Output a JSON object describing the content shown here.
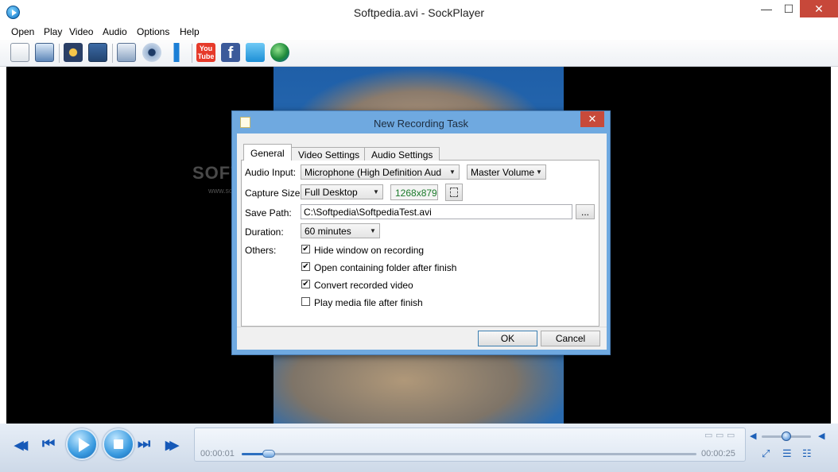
{
  "window": {
    "title": "Softpedia.avi - SockPlayer",
    "minimize_icon": "minimize-icon",
    "maximize_icon": "maximize-icon",
    "close_icon": "close-icon",
    "min_glyph": "—",
    "max_glyph": "☐",
    "close_glyph": "✕"
  },
  "menu": {
    "items": [
      "Open",
      "Play",
      "Video",
      "Audio",
      "Options",
      "Help"
    ]
  },
  "toolbar": {
    "buttons": [
      "open-file-icon",
      "open-dvd-icon",
      "capture-icon",
      "screen-record-icon",
      "screen-icon",
      "webcam-icon",
      "microphone-icon",
      "youtube-icon",
      "facebook-icon",
      "twitter-icon",
      "web-icon"
    ],
    "youtube_text": "You Tube",
    "facebook_text": "f"
  },
  "video": {
    "watermark": "SOFTPEDIA",
    "watermark_sub": "www.softpedia.com"
  },
  "player": {
    "time_current": "00:00:01",
    "time_total": "00:00:25",
    "seek_position_fraction": 0.06,
    "volume_fraction": 0.5,
    "glyph_prev": "◀◀",
    "glyph_start": "⏮",
    "glyph_end": "⏭",
    "glyph_next": "▶▶",
    "glyph_vol": "◀",
    "glyph_vol_max": "◀",
    "glyph_full": "⤢",
    "glyph_list": "☰",
    "glyph_eq": "☷",
    "glyph_a": "▭",
    "glyph_b": "▭",
    "glyph_c": "▭"
  },
  "dialog": {
    "title": "New Recording Task",
    "close_glyph": "✕",
    "tabs": [
      "General",
      "Video Settings",
      "Audio Settings"
    ],
    "audio_input_label": "Audio Input:",
    "audio_input_value": "Microphone (High Definition Aud",
    "audio_source_value": "Master Volume",
    "capture_size_label": "Capture Size:",
    "capture_size_value": "Full Desktop",
    "capture_resolution": "1268x879",
    "save_path_label": "Save Path:",
    "save_path_value": "C:\\Softpedia\\SoftpediaTest.avi",
    "browse_label": "...",
    "duration_label": "Duration:",
    "duration_value": "60 minutes",
    "others_label": "Others:",
    "options": [
      {
        "label": "Hide window on recording",
        "checked": true
      },
      {
        "label": "Open containing folder after finish",
        "checked": true
      },
      {
        "label": "Convert recorded video",
        "checked": true
      },
      {
        "label": "Play media file after finish",
        "checked": false
      }
    ],
    "ok_label": "OK",
    "cancel_label": "Cancel",
    "arrow_glyph": "▼",
    "check_glyph": "✔"
  }
}
